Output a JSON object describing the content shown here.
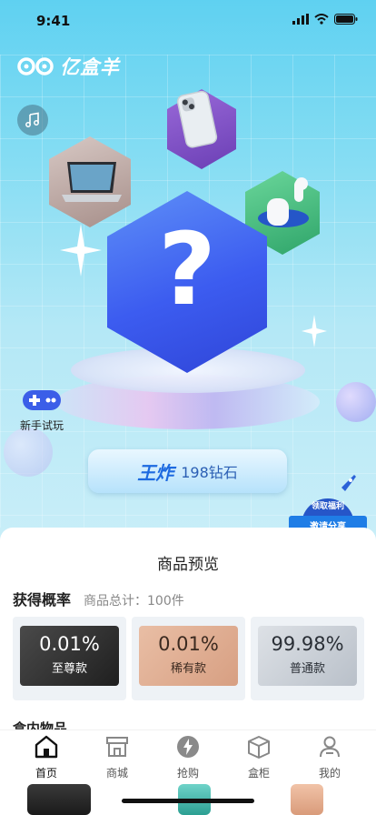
{
  "status_bar": {
    "time": "9:41"
  },
  "app": {
    "logo_text": "亿盒羊"
  },
  "hero": {
    "trial_label": "新手试玩",
    "cta_strong": "王炸",
    "cta_sub": "198钻石",
    "share_line1": "领取福利",
    "share_line2": "邀请分享",
    "mystery_symbol": "?"
  },
  "sheet": {
    "title": "商品预览",
    "probability_title": "获得概率",
    "total_label": "商品总计：100件",
    "cards": [
      {
        "percent": "0.01%",
        "category": "至尊款"
      },
      {
        "percent": "0.01%",
        "category": "稀有款"
      },
      {
        "percent": "99.98%",
        "category": "普通款"
      }
    ],
    "box_items_title": "盒内物品"
  },
  "tabs": [
    {
      "label": "首页",
      "icon": "home-icon"
    },
    {
      "label": "商城",
      "icon": "store-icon"
    },
    {
      "label": "抢购",
      "icon": "lightning-icon"
    },
    {
      "label": "盒柜",
      "icon": "box-icon"
    },
    {
      "label": "我的",
      "icon": "user-icon"
    }
  ],
  "colors": {
    "primary_blue": "#3c5cf0",
    "accent_sky": "#5fd1f1"
  }
}
